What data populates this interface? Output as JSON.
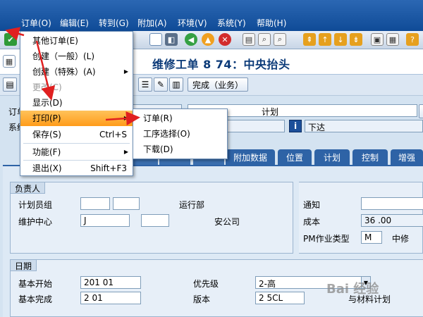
{
  "menubar": {
    "items": [
      {
        "label": "订单(O)"
      },
      {
        "label": "编辑(E)"
      },
      {
        "label": "转到(G)"
      },
      {
        "label": "附加(A)"
      },
      {
        "label": "环境(V)"
      },
      {
        "label": "系统(Y)"
      },
      {
        "label": "帮助(H)"
      }
    ]
  },
  "title": "维修工单 8      74：中央抬头",
  "app_toolbar": {
    "complete_button": "完成（业务）"
  },
  "header": {
    "order_label": "订单",
    "system_label": "系统",
    "description_value": "计划",
    "release_button": "下达"
  },
  "tabs": [
    "附加数据",
    "位置",
    "计划",
    "控制",
    "增强"
  ],
  "responsible": {
    "title": "负责人",
    "planner_group_label": "计划员组",
    "planner_group_text": "运行部",
    "work_center_label": "维护中心",
    "work_center_text": "安公司",
    "notification_label": "通知",
    "cost_label": "成本",
    "cost_value": "36      .00",
    "pm_type_label": "PM作业类型",
    "pm_type_value": "M",
    "pm_type_text": "中修"
  },
  "dates": {
    "title": "日期",
    "start_label": "基本开始",
    "start_value": "201        01",
    "finish_label": "基本完成",
    "finish_value": "2          01",
    "priority_label": "优先级",
    "priority_value": "2-高",
    "revision_label": "版本",
    "revision_value": "2      5CL",
    "revision_text": "与材料计划"
  },
  "dropdown": {
    "items": [
      {
        "label": "其他订单(E)",
        "shortcut": "",
        "submenu": false,
        "disabled": false
      },
      {
        "label": "创建（一般）(L)",
        "shortcut": "",
        "submenu": false,
        "disabled": false
      },
      {
        "label": "创建（特殊）(A)",
        "shortcut": "",
        "submenu": true,
        "disabled": false
      },
      {
        "label": "更改(C)",
        "shortcut": "",
        "submenu": false,
        "disabled": true
      },
      {
        "label": "显示(D)",
        "shortcut": "",
        "submenu": false,
        "disabled": false
      },
      {
        "label": "打印(P)",
        "shortcut": "",
        "submenu": true,
        "disabled": false
      },
      {
        "label": "保存(S)",
        "shortcut": "Ctrl+S",
        "submenu": false,
        "disabled": false
      },
      {
        "label": "功能(F)",
        "shortcut": "",
        "submenu": true,
        "disabled": false
      },
      {
        "label": "退出(X)",
        "shortcut": "Shift+F3",
        "submenu": false,
        "disabled": false
      }
    ]
  },
  "print_submenu": {
    "items": [
      {
        "label": "订单(R)"
      },
      {
        "label": "工序选择(O)"
      },
      {
        "label": "下载(D)"
      }
    ]
  },
  "watermark": "Bai 经验",
  "colors": {
    "accent": "#ff9c1a",
    "menubar": "#1a56a3",
    "tab": "#2e63a6",
    "arrow": "#e02020"
  }
}
